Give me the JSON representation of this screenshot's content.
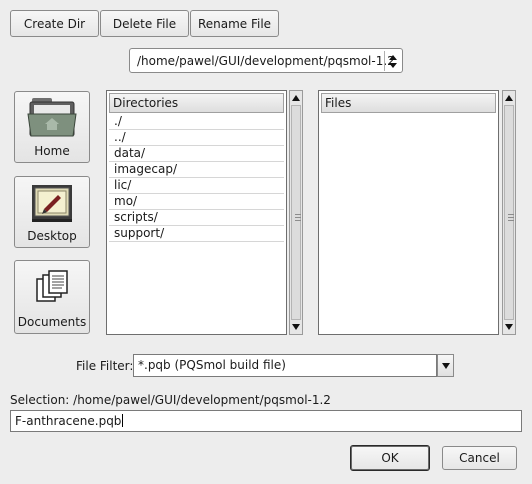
{
  "toolbar": {
    "create_dir": "Create Dir",
    "delete_file": "Delete File",
    "rename_file": "Rename File"
  },
  "path_combo": {
    "value": "/home/pawel/GUI/development/pqsmol-1.2"
  },
  "places": [
    {
      "label": "Home",
      "icon": "home-folder-icon"
    },
    {
      "label": "Desktop",
      "icon": "desktop-icon"
    },
    {
      "label": "Documents",
      "icon": "documents-icon"
    }
  ],
  "directories": {
    "header": "Directories",
    "items": [
      "./",
      "../",
      "data/",
      "imagecap/",
      "lic/",
      "mo/",
      "scripts/",
      "support/"
    ]
  },
  "files": {
    "header": "Files",
    "items": []
  },
  "filter": {
    "label": "File Filter:",
    "value": "*.pqb (PQSmol build file)"
  },
  "selection": {
    "label": "Selection: /home/pawel/GUI/development/pqsmol-1.2",
    "value": "F-anthracene.pqb"
  },
  "dialog": {
    "ok": "OK",
    "cancel": "Cancel"
  }
}
